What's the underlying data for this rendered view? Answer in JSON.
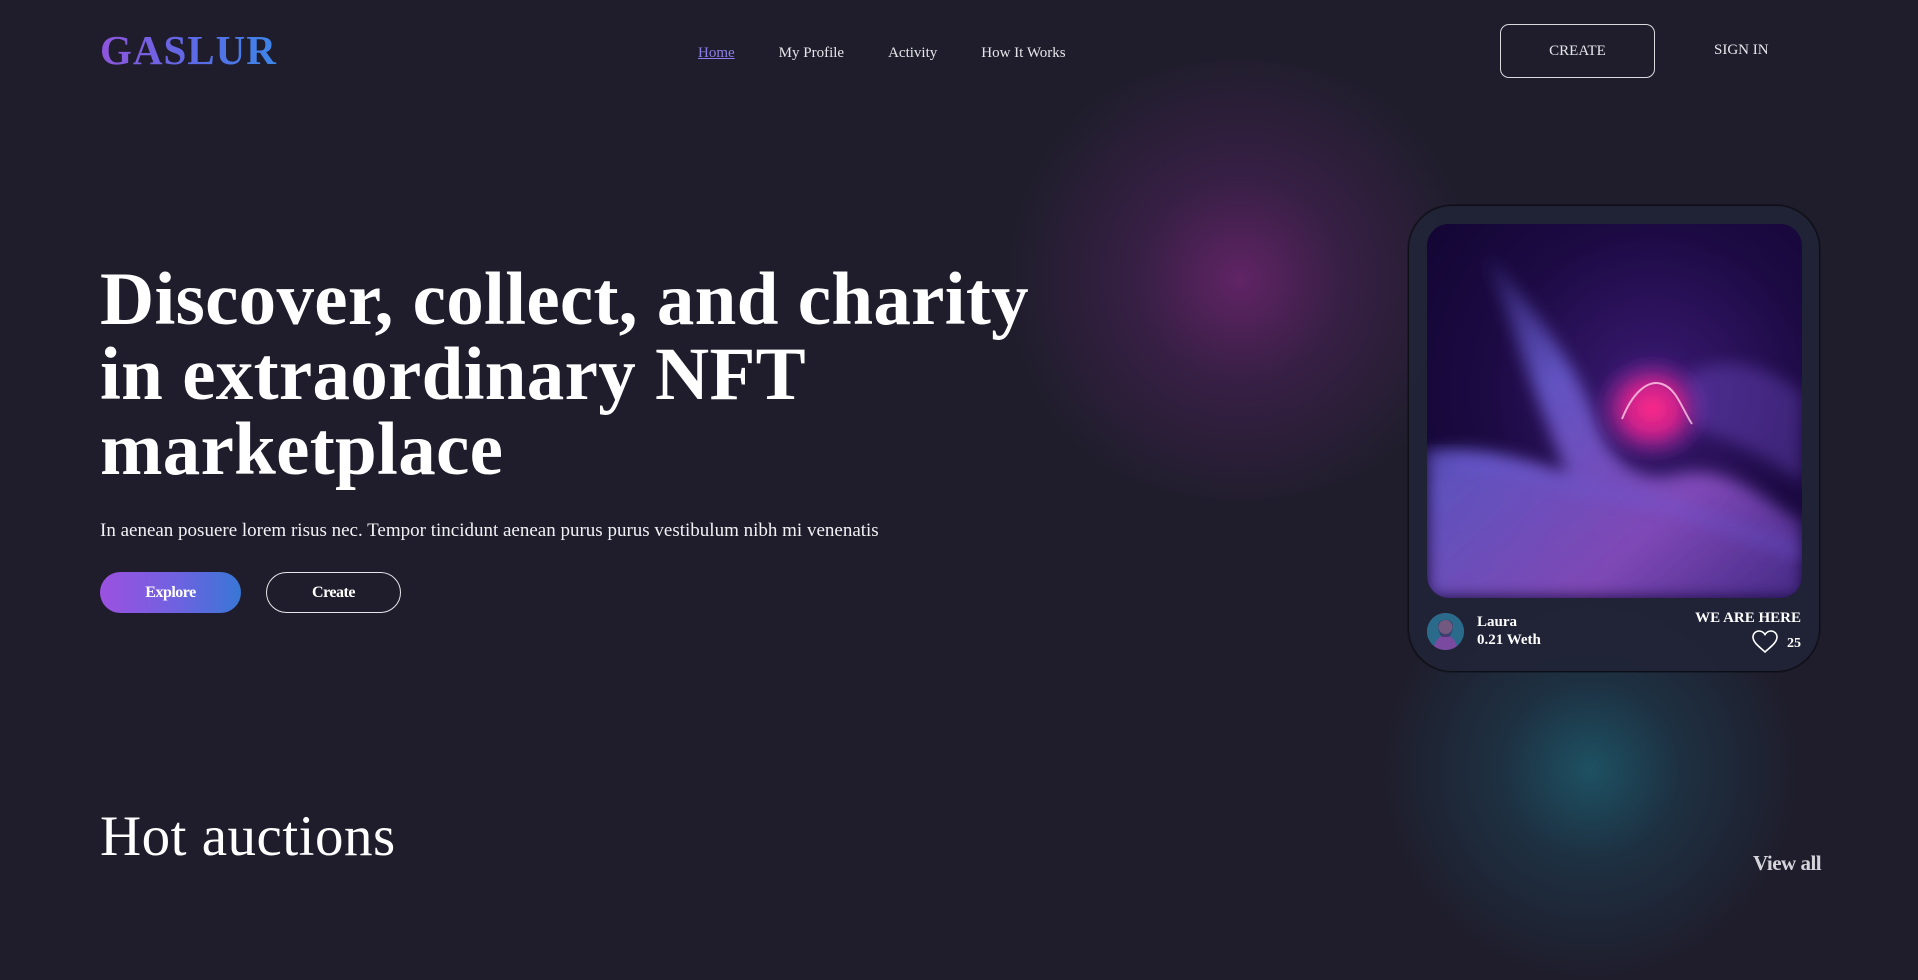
{
  "brand": {
    "logo": "GASLUR"
  },
  "nav": {
    "items": [
      {
        "label": "Home",
        "active": true
      },
      {
        "label": "My Profile",
        "active": false
      },
      {
        "label": "Activity",
        "active": false
      },
      {
        "label": "How It Works",
        "active": false
      }
    ],
    "create_label": "CREATE",
    "signin_label": "SIGN IN"
  },
  "hero": {
    "title": "Discover, collect, and charity in extraordinary NFT marketplace",
    "subtitle": "In aenean posuere lorem risus nec. Tempor tincidunt aenean purus purus vestibulum nibh mi venenatis",
    "explore_label": "Explore",
    "create_label": "Create"
  },
  "featured_card": {
    "creator_name": "Laura",
    "price": "0.21 Weth",
    "title": "WE ARE HERE",
    "likes": "25",
    "avatar_icon": "avatar",
    "like_icon": "heart-icon"
  },
  "section": {
    "title": "Hot auctions",
    "view_all_label": "View all"
  },
  "colors": {
    "background": "#1f1d2c",
    "accent_purple": "#9c51e0",
    "accent_blue": "#3877d6",
    "nav_active": "#8c7ee8"
  }
}
